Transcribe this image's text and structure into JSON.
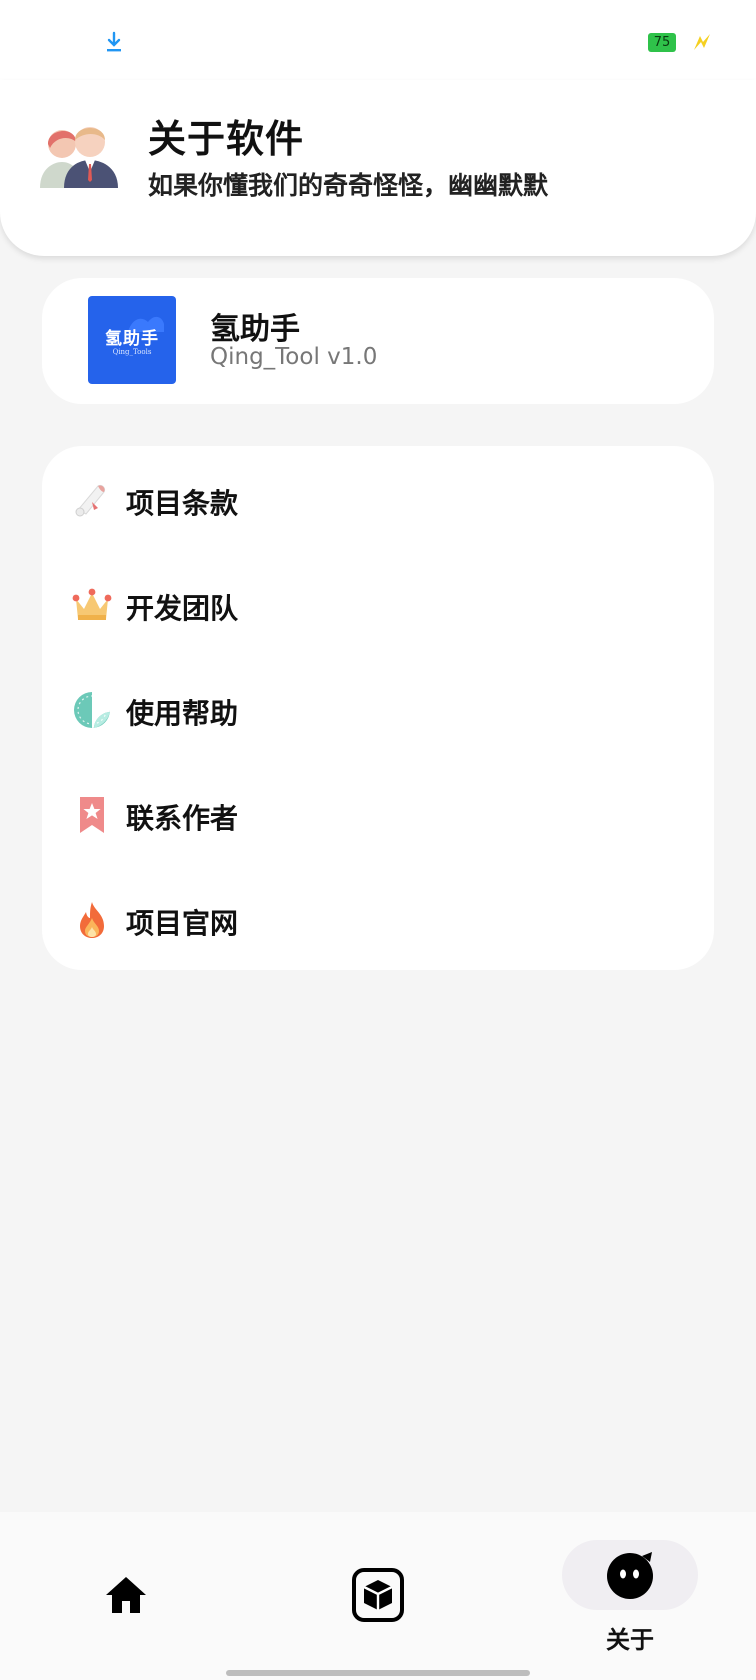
{
  "status_bar": {
    "battery_level": "75",
    "download_icon": "download-arrow-icon",
    "charge_icon": "charging-bolt-icon"
  },
  "header": {
    "title": "关于软件",
    "subtitle": "如果你懂我们的奇奇怪怪，幽幽默默",
    "avatar_icon": "users-avatar-icon"
  },
  "app": {
    "name": "氢助手",
    "version": "Qing_Tool  v1.0",
    "logo_text": "氢助手",
    "logo_subtext": "Qing_Tools"
  },
  "menu": {
    "items": [
      {
        "label": "项目条款",
        "icon": "scroll-icon"
      },
      {
        "label": "开发团队",
        "icon": "crown-icon"
      },
      {
        "label": "使用帮助",
        "icon": "sticker-icon"
      },
      {
        "label": "联系作者",
        "icon": "bookmark-star-icon"
      },
      {
        "label": "项目官网",
        "icon": "fire-icon"
      }
    ]
  },
  "bottom_nav": {
    "items": [
      {
        "name": "home",
        "icon": "home-icon",
        "label": ""
      },
      {
        "name": "toolbox",
        "icon": "box-icon",
        "label": ""
      },
      {
        "name": "about",
        "icon": "about-face-icon",
        "label": "关于",
        "selected": true
      }
    ]
  },
  "colors": {
    "background": "#f5f5f5",
    "card": "#ffffff",
    "logo_blue": "#2563eb",
    "battery_green": "#2fc24a",
    "nav_selected_pill": "#f0eef2"
  }
}
